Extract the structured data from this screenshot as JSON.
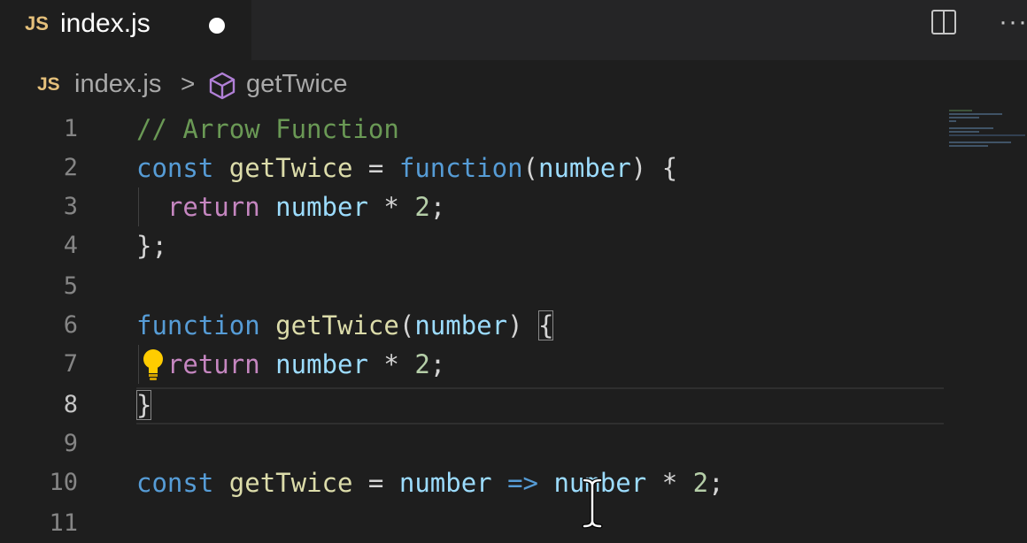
{
  "tab": {
    "language_badge": "JS",
    "title": "index.js",
    "dirty": true
  },
  "toolbar": {
    "split_icon": "split-editor-icon",
    "more_icon": "more-actions-icon",
    "more_glyph": "···"
  },
  "breadcrumb": {
    "language_badge": "JS",
    "file": "index.js",
    "separator": ">",
    "symbol_icon": "symbol-cube-icon",
    "symbol": "getTwice"
  },
  "editor": {
    "active_line": 8,
    "line_numbers": [
      "1",
      "2",
      "3",
      "4",
      "5",
      "6",
      "7",
      "8",
      "9",
      "10",
      "11"
    ],
    "lines": {
      "l1": {
        "comment": "// Arrow Function"
      },
      "l2": {
        "t1": "const",
        "t2": "getTwice",
        "t3": " = ",
        "t4": "function",
        "t5": "(",
        "t6": "number",
        "t7": ") {"
      },
      "l3": {
        "t1": "return",
        "t2": "number",
        "t3": " * ",
        "t4": "2",
        "t5": ";"
      },
      "l4": {
        "t1": "};"
      },
      "l6": {
        "t1": "function",
        "t2": "getTwice",
        "t3": "(",
        "t4": "number",
        "t5": ") ",
        "t6": "{"
      },
      "l7": {
        "t1": "return",
        "t2": "number",
        "t3": " * ",
        "t4": "2",
        "t5": ";"
      },
      "l8": {
        "t1": "}"
      },
      "l10": {
        "t1": "const",
        "t2": "getTwice",
        "t3": " = ",
        "t4": "number",
        "t5": " => ",
        "t6": "number",
        "t7": " * ",
        "t8": "2",
        "t9": ";"
      }
    },
    "lightbulb_icon": "lightbulb-icon",
    "mouse_cursor_icon": "text-cursor-icon"
  },
  "colors": {
    "background": "#1e1e1e",
    "tab_bar": "#252526",
    "keyword": "#569cd6",
    "control": "#c586c0",
    "function": "#dcdcaa",
    "variable": "#9cdcfe",
    "number": "#b5cea8",
    "comment": "#6a9955",
    "js_badge": "#e5c07b"
  }
}
